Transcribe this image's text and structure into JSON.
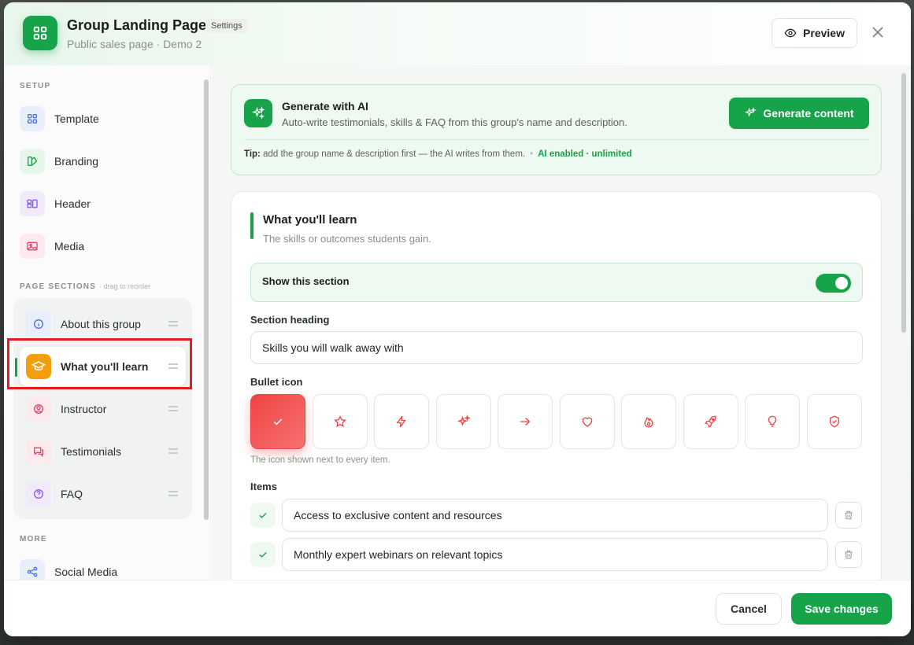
{
  "header": {
    "title": "Group Landing Page",
    "badge": "Settings",
    "subtitle": "Public sales page · Demo 2",
    "preview_label": "Preview"
  },
  "sidebar": {
    "setup_label": "SETUP",
    "setup_items": [
      {
        "label": "Template",
        "icon": "grid-icon"
      },
      {
        "label": "Branding",
        "icon": "palette-icon"
      },
      {
        "label": "Header",
        "icon": "layout-icon"
      },
      {
        "label": "Media",
        "icon": "image-icon"
      }
    ],
    "sections_label": "PAGE SECTIONS",
    "sections_hint": "· drag to reorder",
    "section_items": [
      {
        "label": "About this group",
        "icon": "info-icon"
      },
      {
        "label": "What you'll learn",
        "icon": "graduation-cap-icon",
        "active": true
      },
      {
        "label": "Instructor",
        "icon": "user-icon"
      },
      {
        "label": "Testimonials",
        "icon": "chat-icon"
      },
      {
        "label": "FAQ",
        "icon": "question-icon"
      }
    ],
    "more_label": "MORE",
    "more_items": [
      {
        "label": "Social Media",
        "icon": "share-icon"
      }
    ]
  },
  "ai": {
    "title": "Generate with AI",
    "description": "Auto-write testimonials, skills & FAQ from this group's name and description.",
    "button_label": "Generate content",
    "tip_label": "Tip:",
    "tip_text": "add the group name & description first — the AI writes from them.",
    "status": "AI enabled · unlimited"
  },
  "section": {
    "title": "What you'll learn",
    "subtitle": "The skills or outcomes students gain.",
    "toggle_label": "Show this section",
    "toggle_on": true,
    "heading_label": "Section heading",
    "heading_value": "Skills you will walk away with",
    "bullet_icon_label": "Bullet icon",
    "bullet_icons": [
      "check-icon",
      "star-icon",
      "bolt-icon",
      "sparkle-icon",
      "arrow-right-icon",
      "heart-icon",
      "flame-icon",
      "rocket-icon",
      "lightbulb-icon",
      "shield-check-icon"
    ],
    "bullet_icon_selected": "check-icon",
    "bullet_hint": "The icon shown next to every item.",
    "items_label": "Items",
    "items": [
      "Access to exclusive content and resources",
      "Monthly expert webinars on relevant topics"
    ]
  },
  "footer": {
    "cancel_label": "Cancel",
    "save_label": "Save changes"
  },
  "colors": {
    "accent": "#16a34a",
    "bullet_accent": "#ef4444",
    "highlight_box": "#e11d1d"
  }
}
